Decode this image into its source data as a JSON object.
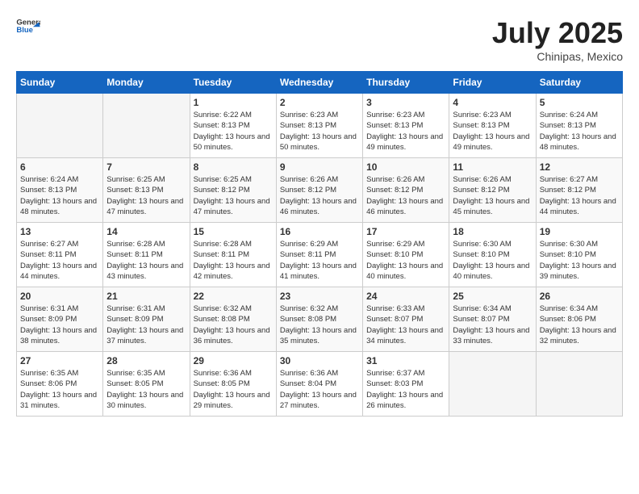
{
  "header": {
    "logo_general": "General",
    "logo_blue": "Blue",
    "month": "July 2025",
    "location": "Chinipas, Mexico"
  },
  "weekdays": [
    "Sunday",
    "Monday",
    "Tuesday",
    "Wednesday",
    "Thursday",
    "Friday",
    "Saturday"
  ],
  "weeks": [
    [
      {
        "day": "",
        "empty": true
      },
      {
        "day": "",
        "empty": true
      },
      {
        "day": "1",
        "sunrise": "6:22 AM",
        "sunset": "8:13 PM",
        "daylight": "13 hours and 50 minutes."
      },
      {
        "day": "2",
        "sunrise": "6:23 AM",
        "sunset": "8:13 PM",
        "daylight": "13 hours and 50 minutes."
      },
      {
        "day": "3",
        "sunrise": "6:23 AM",
        "sunset": "8:13 PM",
        "daylight": "13 hours and 49 minutes."
      },
      {
        "day": "4",
        "sunrise": "6:23 AM",
        "sunset": "8:13 PM",
        "daylight": "13 hours and 49 minutes."
      },
      {
        "day": "5",
        "sunrise": "6:24 AM",
        "sunset": "8:13 PM",
        "daylight": "13 hours and 48 minutes."
      }
    ],
    [
      {
        "day": "6",
        "sunrise": "6:24 AM",
        "sunset": "8:13 PM",
        "daylight": "13 hours and 48 minutes."
      },
      {
        "day": "7",
        "sunrise": "6:25 AM",
        "sunset": "8:13 PM",
        "daylight": "13 hours and 47 minutes."
      },
      {
        "day": "8",
        "sunrise": "6:25 AM",
        "sunset": "8:12 PM",
        "daylight": "13 hours and 47 minutes."
      },
      {
        "day": "9",
        "sunrise": "6:26 AM",
        "sunset": "8:12 PM",
        "daylight": "13 hours and 46 minutes."
      },
      {
        "day": "10",
        "sunrise": "6:26 AM",
        "sunset": "8:12 PM",
        "daylight": "13 hours and 46 minutes."
      },
      {
        "day": "11",
        "sunrise": "6:26 AM",
        "sunset": "8:12 PM",
        "daylight": "13 hours and 45 minutes."
      },
      {
        "day": "12",
        "sunrise": "6:27 AM",
        "sunset": "8:12 PM",
        "daylight": "13 hours and 44 minutes."
      }
    ],
    [
      {
        "day": "13",
        "sunrise": "6:27 AM",
        "sunset": "8:11 PM",
        "daylight": "13 hours and 44 minutes."
      },
      {
        "day": "14",
        "sunrise": "6:28 AM",
        "sunset": "8:11 PM",
        "daylight": "13 hours and 43 minutes."
      },
      {
        "day": "15",
        "sunrise": "6:28 AM",
        "sunset": "8:11 PM",
        "daylight": "13 hours and 42 minutes."
      },
      {
        "day": "16",
        "sunrise": "6:29 AM",
        "sunset": "8:11 PM",
        "daylight": "13 hours and 41 minutes."
      },
      {
        "day": "17",
        "sunrise": "6:29 AM",
        "sunset": "8:10 PM",
        "daylight": "13 hours and 40 minutes."
      },
      {
        "day": "18",
        "sunrise": "6:30 AM",
        "sunset": "8:10 PM",
        "daylight": "13 hours and 40 minutes."
      },
      {
        "day": "19",
        "sunrise": "6:30 AM",
        "sunset": "8:10 PM",
        "daylight": "13 hours and 39 minutes."
      }
    ],
    [
      {
        "day": "20",
        "sunrise": "6:31 AM",
        "sunset": "8:09 PM",
        "daylight": "13 hours and 38 minutes."
      },
      {
        "day": "21",
        "sunrise": "6:31 AM",
        "sunset": "8:09 PM",
        "daylight": "13 hours and 37 minutes."
      },
      {
        "day": "22",
        "sunrise": "6:32 AM",
        "sunset": "8:08 PM",
        "daylight": "13 hours and 36 minutes."
      },
      {
        "day": "23",
        "sunrise": "6:32 AM",
        "sunset": "8:08 PM",
        "daylight": "13 hours and 35 minutes."
      },
      {
        "day": "24",
        "sunrise": "6:33 AM",
        "sunset": "8:07 PM",
        "daylight": "13 hours and 34 minutes."
      },
      {
        "day": "25",
        "sunrise": "6:34 AM",
        "sunset": "8:07 PM",
        "daylight": "13 hours and 33 minutes."
      },
      {
        "day": "26",
        "sunrise": "6:34 AM",
        "sunset": "8:06 PM",
        "daylight": "13 hours and 32 minutes."
      }
    ],
    [
      {
        "day": "27",
        "sunrise": "6:35 AM",
        "sunset": "8:06 PM",
        "daylight": "13 hours and 31 minutes."
      },
      {
        "day": "28",
        "sunrise": "6:35 AM",
        "sunset": "8:05 PM",
        "daylight": "13 hours and 30 minutes."
      },
      {
        "day": "29",
        "sunrise": "6:36 AM",
        "sunset": "8:05 PM",
        "daylight": "13 hours and 29 minutes."
      },
      {
        "day": "30",
        "sunrise": "6:36 AM",
        "sunset": "8:04 PM",
        "daylight": "13 hours and 27 minutes."
      },
      {
        "day": "31",
        "sunrise": "6:37 AM",
        "sunset": "8:03 PM",
        "daylight": "13 hours and 26 minutes."
      },
      {
        "day": "",
        "empty": true
      },
      {
        "day": "",
        "empty": true
      }
    ]
  ]
}
